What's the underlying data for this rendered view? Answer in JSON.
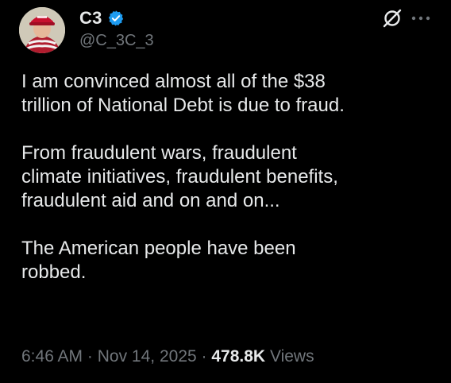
{
  "author": {
    "display_name": "C3",
    "handle": "@C_3C_3",
    "verified": true,
    "avatar_icon": "avatar-icon"
  },
  "header_icons": {
    "grok": "grok-icon",
    "more": "more-icon"
  },
  "tweet": {
    "paragraphs": [
      "I am convinced almost all of the $38\ntrillion of National Debt is due to fraud.",
      "From fraudulent wars, fraudulent\nclimate initiatives, fraudulent benefits,\nfraudulent aid and on and on...",
      "The American people have been\nrobbed."
    ]
  },
  "meta": {
    "time": "6:46 AM",
    "separator": "·",
    "date": "Nov 14, 2025",
    "views_count": "478.8K",
    "views_label": "Views"
  },
  "colors": {
    "background": "#000000",
    "text_primary": "#e7e9ea",
    "text_secondary": "#71767b",
    "verified_blue": "#1d9bf0"
  }
}
